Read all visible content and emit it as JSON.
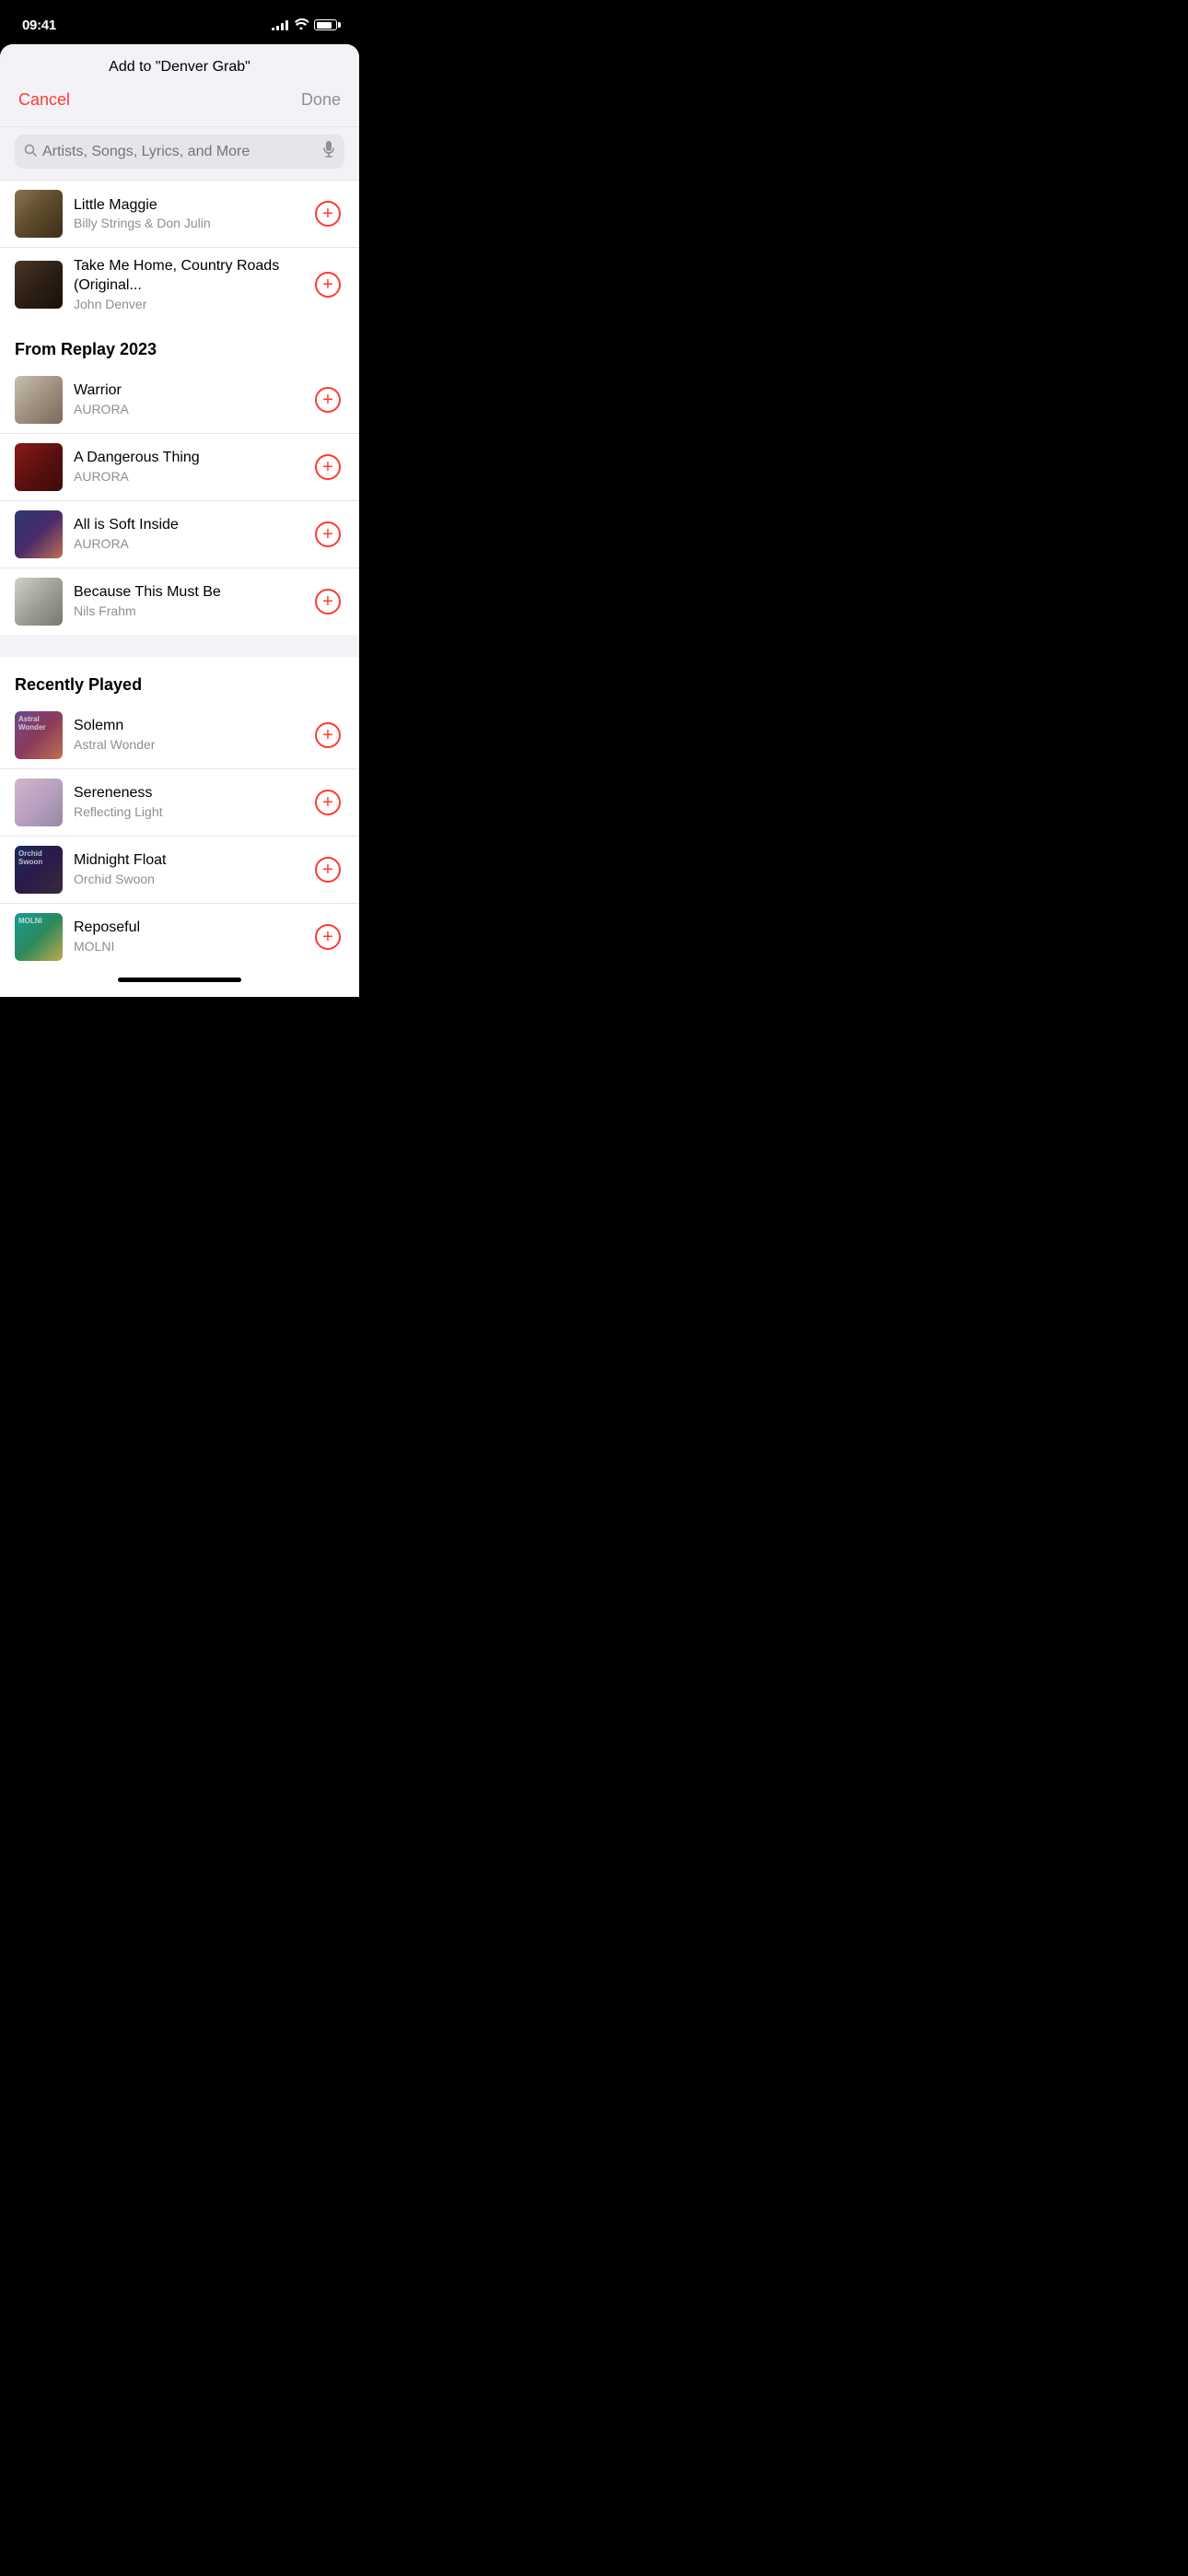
{
  "statusBar": {
    "time": "09:41"
  },
  "header": {
    "title": "Add to \"Denver Grab\"",
    "cancelLabel": "Cancel",
    "doneLabel": "Done"
  },
  "search": {
    "placeholder": "Artists, Songs, Lyrics, and More"
  },
  "topSongs": [
    {
      "id": "little-maggie",
      "title": "Little Maggie",
      "artist": "Billy Strings & Don Julin",
      "artClass": "art-billy"
    },
    {
      "id": "take-me-home",
      "title": "Take Me Home, Country Roads (Original...",
      "artist": "John Denver",
      "artClass": "art-denver"
    }
  ],
  "sections": [
    {
      "id": "replay-2023",
      "title": "From Replay 2023",
      "songs": [
        {
          "id": "warrior",
          "title": "Warrior",
          "artist": "AURORA",
          "artClass": "art-warrior"
        },
        {
          "id": "dangerous-thing",
          "title": "A Dangerous Thing",
          "artist": "AURORA",
          "artClass": "art-dangerous"
        },
        {
          "id": "all-is-soft",
          "title": "All is Soft Inside",
          "artist": "AURORA",
          "artClass": "art-soft"
        },
        {
          "id": "because-this-must-be",
          "title": "Because This Must Be",
          "artist": "Nils Frahm",
          "artClass": "art-because"
        }
      ]
    },
    {
      "id": "recently-played",
      "title": "Recently Played",
      "songs": [
        {
          "id": "solemn",
          "title": "Solemn",
          "artist": "Astral Wonder",
          "artClass": "art-solemn",
          "artLabel": "Astral Wonder"
        },
        {
          "id": "sereneness",
          "title": "Sereneness",
          "artist": "Reflecting Light",
          "artClass": "art-sereneness"
        },
        {
          "id": "midnight-float",
          "title": "Midnight Float",
          "artist": "Orchid Swoon",
          "artClass": "art-midnight",
          "artLabel": "Orchid Swoon"
        },
        {
          "id": "reposeful",
          "title": "Reposeful",
          "artist": "MOLNI",
          "artClass": "art-reposeful",
          "artLabel": "MOLNI"
        }
      ]
    }
  ]
}
